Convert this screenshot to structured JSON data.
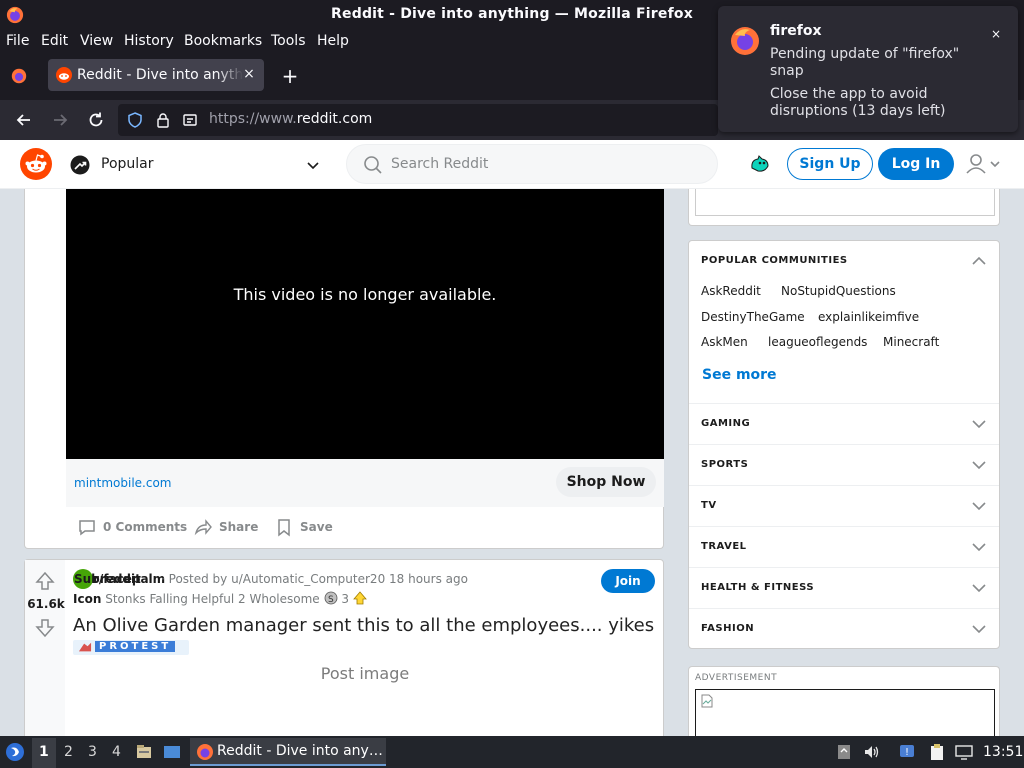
{
  "window": {
    "title": "Reddit - Dive into anything — Mozilla Firefox"
  },
  "menu": [
    "File",
    "Edit",
    "View",
    "History",
    "Bookmarks",
    "Tools",
    "Help"
  ],
  "tab": {
    "title": "Reddit - Dive into anything",
    "close": "×"
  },
  "urlbar": {
    "scheme": "https://www.",
    "host": "reddit.com"
  },
  "notification": {
    "app": "firefox",
    "line1": "Pending update of \"firefox\" snap",
    "line2": "Close the app to avoid disruptions (13 days left)",
    "close": "×"
  },
  "reddit": {
    "feed_label": "Popular",
    "search_placeholder": "Search Reddit",
    "signup": "Sign Up",
    "login": "Log In"
  },
  "ad_post": {
    "video_message": "This video is no longer available.",
    "domain": "mintmobile.com",
    "cta": "Shop Now",
    "comments": "0 Comments",
    "share": "Share",
    "save": "Save"
  },
  "post": {
    "votes": "61.6k",
    "subreddit_overlap_a": "Subreddit",
    "subreddit_overlap_b": "r/facepalm",
    "posted_by": "· Posted by u/Automatic_Computer20 18 hours ago",
    "icon_label": "Icon",
    "awards": "Stonks Falling  Helpful 2  Wholesome",
    "award_count": "3",
    "join": "Join",
    "title": "An Olive Garden manager sent this to all the employees.... yikes",
    "flair": "PROTEST",
    "image_placeholder": "Post image"
  },
  "sidebar": {
    "popular_heading": "POPULAR COMMUNITIES",
    "communities": [
      [
        "AskReddit",
        "NoStupidQuestions"
      ],
      [
        "DestinyTheGame",
        "explainlikeimfive"
      ],
      [
        "AskMen",
        "leagueoflegends",
        "Minecraft"
      ]
    ],
    "see_more": "See more",
    "categories": [
      "GAMING",
      "SPORTS",
      "TV",
      "TRAVEL",
      "HEALTH & FITNESS",
      "FASHION"
    ],
    "advertisement": "ADVERTISEMENT"
  },
  "taskbar": {
    "workspaces": [
      "1",
      "2",
      "3",
      "4"
    ],
    "task": "Reddit - Dive into any…",
    "clock": "13:51"
  },
  "colors": {
    "reddit_blue": "#0079d3",
    "reddit_orange": "#ff4500",
    "firefox_dark": "#1c1b22"
  }
}
